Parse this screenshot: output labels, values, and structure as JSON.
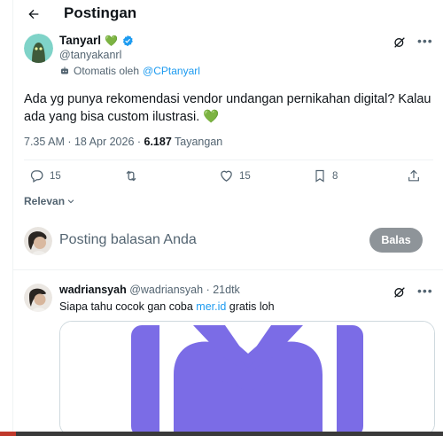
{
  "header": {
    "title": "Postingan",
    "back_icon": "arrow-left-icon"
  },
  "tweet": {
    "author_name": "Tanyarl",
    "author_emoji": "💚",
    "handle": "@tanyakanrl",
    "automated_prefix": "Otomatis oleh",
    "automated_by": "@CPtanyarl",
    "text": "Ada yg punya rekomendasi vendor undangan pernikahan digital? Kalau ada yang bisa custom ilustrasi. 💚",
    "time": "7.35 AM · 18 Apr 2026 · ",
    "views_count": "6.187",
    "views_label": "Tayangan",
    "actions": {
      "replies": "15",
      "retweets": "",
      "likes": "15",
      "bookmarks": "8"
    }
  },
  "sort": {
    "label": "Relevan"
  },
  "compose": {
    "placeholder": "Posting balasan Anda",
    "button_label": "Balas"
  },
  "reply": {
    "name": "wadriansyah",
    "handle": "@wadriansyah",
    "time": "· 21dtk",
    "text_prefix": "Siapa tahu cocok gan coba ",
    "link": "mer.id",
    "text_suffix": " gratis loh"
  },
  "colors": {
    "accent": "#1d9bf0",
    "verified": "#1d9bf0",
    "media_logo": "#7b6ce6",
    "button_disabled": "#8e9499"
  }
}
